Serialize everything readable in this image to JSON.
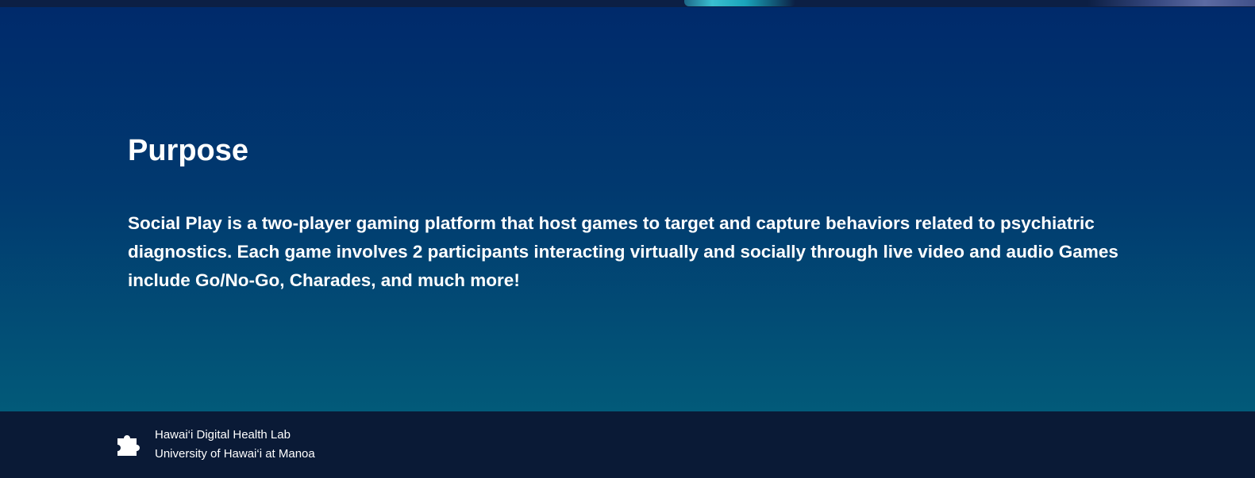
{
  "hero": {
    "title": "Purpose",
    "description": "Social Play is a two-player gaming platform that host games to target and capture behaviors related to psychiatric diagnostics. Each game involves 2 participants interacting virtually and socially through live video and audio Games include Go/No-Go, Charades, and much more!"
  },
  "footer": {
    "icon": "puzzle-piece-icon",
    "lab_name": "Hawai‘i Digital Health Lab",
    "university": "University of Hawai‘i at Manoa"
  },
  "colors": {
    "hero_gradient_top": "#002a6b",
    "hero_gradient_bottom": "#025a79",
    "footer_background": "#0a1a36",
    "text": "#ffffff"
  }
}
